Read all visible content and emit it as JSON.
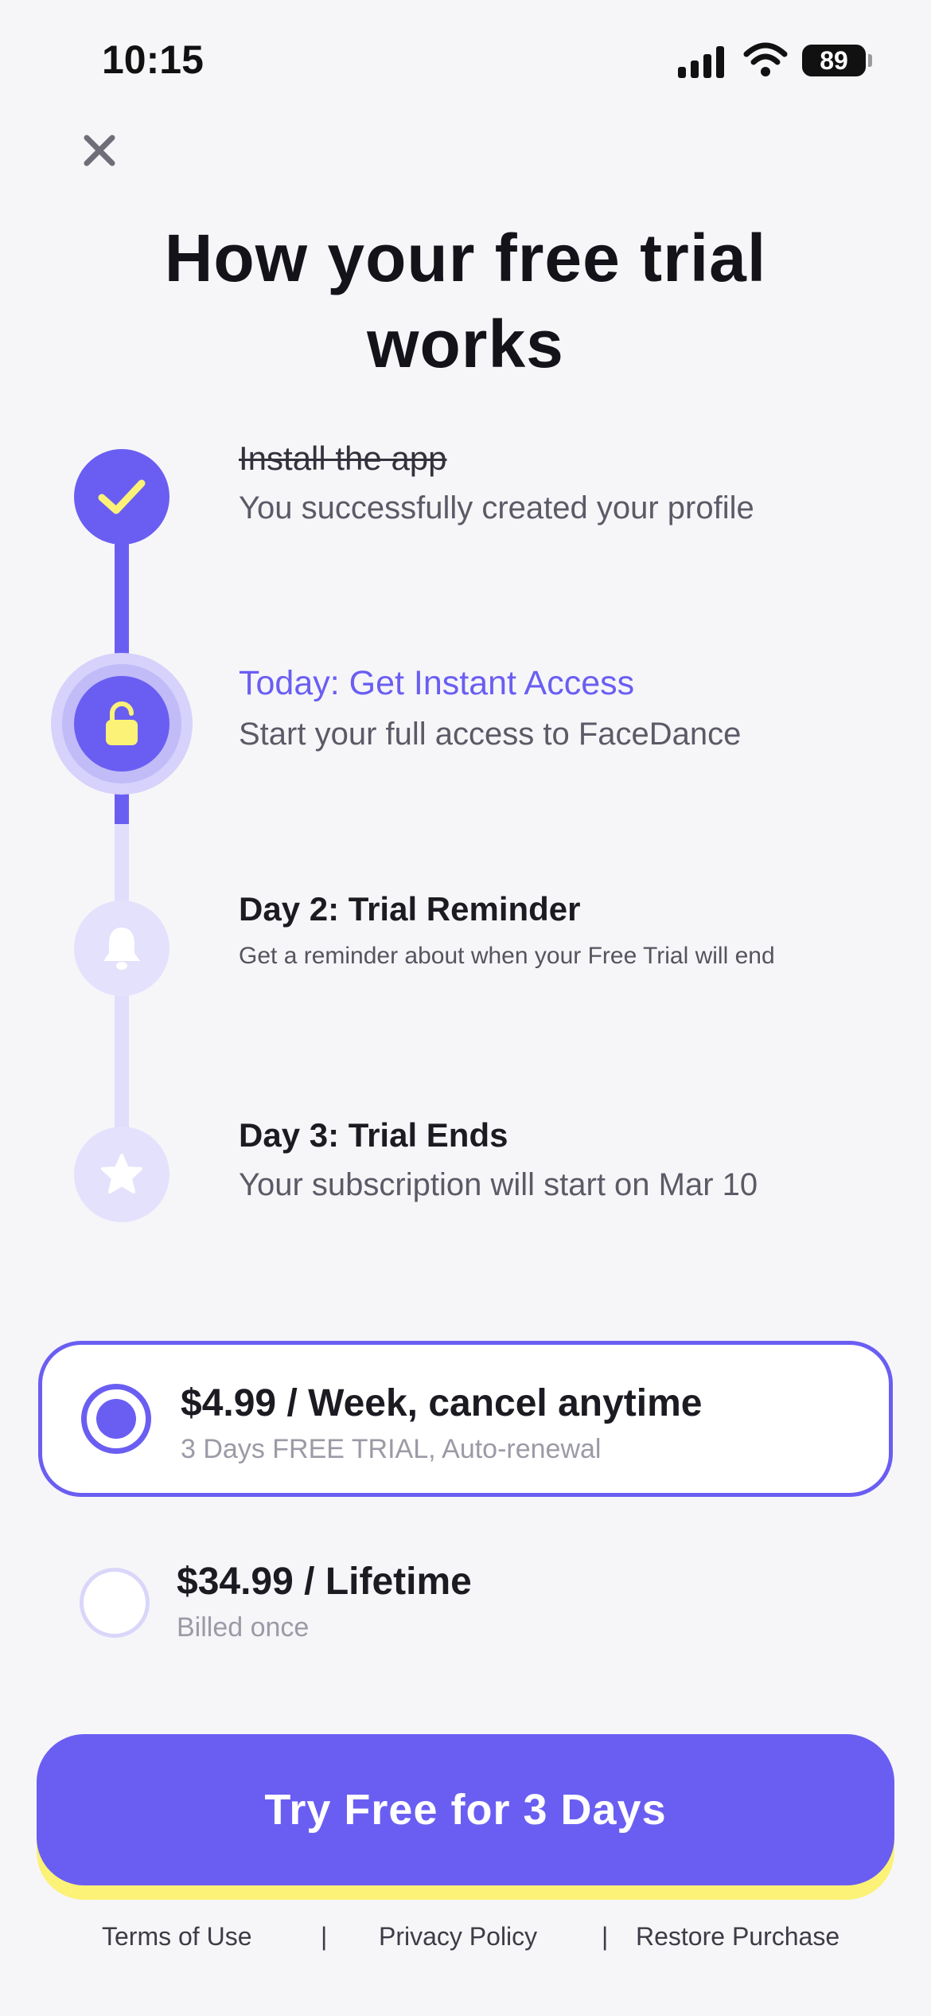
{
  "status_bar": {
    "time": "10:15",
    "battery": "89",
    "icons": [
      "cellular-signal-icon",
      "wifi-icon",
      "battery-icon"
    ]
  },
  "close_icon": "close-icon",
  "title": "How your free trial works",
  "steps": [
    {
      "title": "Install the app",
      "description": "You successfully created your profile",
      "icon": "check-icon",
      "state": "completed"
    },
    {
      "title": "Today: Get Instant Access",
      "description": "Start your full access to FaceDance",
      "icon": "unlock-icon",
      "state": "current"
    },
    {
      "title": "Day 2: Trial Reminder",
      "description": "Get a reminder about when your Free Trial will end",
      "icon": "bell-icon",
      "state": "upcoming"
    },
    {
      "title": "Day 3: Trial Ends",
      "description": "Your subscription will start on Mar 10",
      "icon": "star-icon",
      "state": "upcoming"
    }
  ],
  "plans": [
    {
      "name": "$4.99 / Week, cancel anytime",
      "subtitle": "3 Days FREE TRIAL, Auto-renewal",
      "selected": true
    },
    {
      "name": "$34.99 / Lifetime",
      "subtitle": "Billed once",
      "selected": false
    }
  ],
  "cta": {
    "label": "Try Free for 3 Days"
  },
  "footer": {
    "terms": "Terms of Use",
    "privacy": "Privacy Policy",
    "restore": "Restore Purchase",
    "separator": "|"
  },
  "colors": {
    "accent": "#6a5ef2",
    "accent_light": "#e1defc",
    "highlight": "#fbf277",
    "background": "#f6f6f9"
  }
}
